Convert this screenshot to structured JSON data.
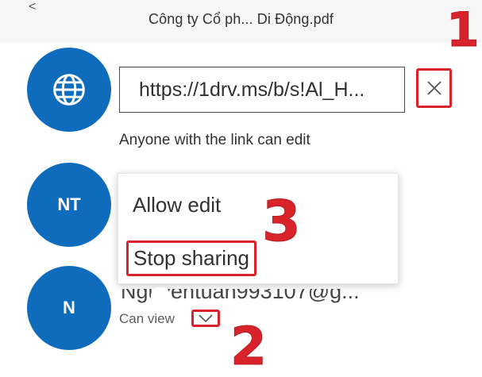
{
  "header": {
    "file_title": "Công ty Cổ ph... Di Động.pdf"
  },
  "link_share": {
    "url": "https://1drv.ms/b/s!Al_H...",
    "permission_text": "Anyone with the link can edit",
    "remove_icon": "close-icon"
  },
  "people": [
    {
      "initials": "NT"
    },
    {
      "initials": "N",
      "email": "Nguyentuan993107@g...",
      "permission": "Can view"
    }
  ],
  "menu": {
    "items": [
      "Allow edit",
      "Stop sharing"
    ]
  },
  "annotations": [
    "1",
    "2",
    "3"
  ],
  "colors": {
    "accent": "#0f6cbd",
    "annotation": "#d9232b"
  }
}
